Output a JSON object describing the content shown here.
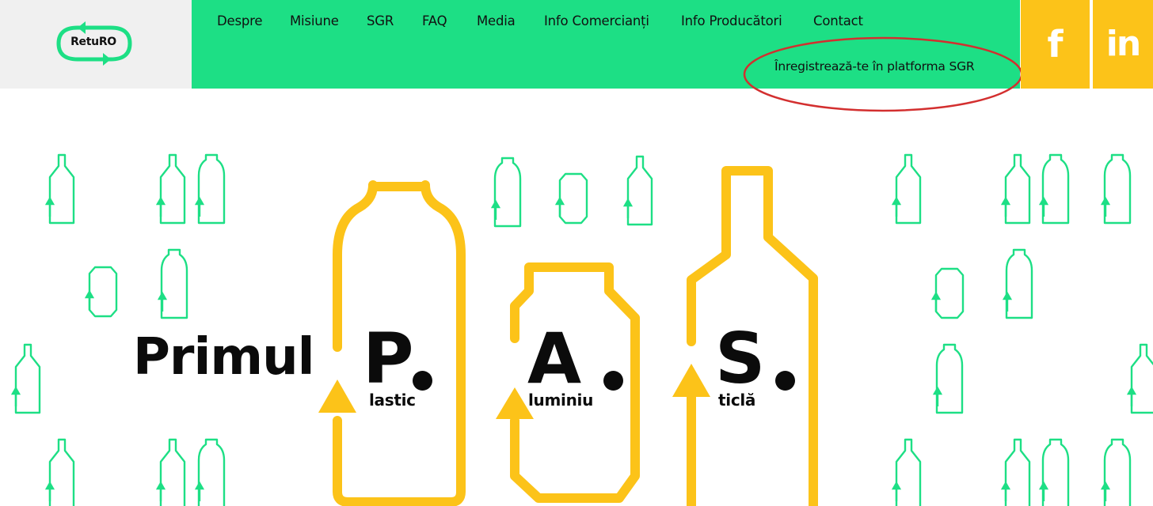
{
  "brand": {
    "logo_text": "RetuRO"
  },
  "nav": {
    "items": [
      {
        "label": "Despre"
      },
      {
        "label": "Misiune"
      },
      {
        "label": "SGR"
      },
      {
        "label": "FAQ"
      },
      {
        "label": "Media"
      },
      {
        "label": "Info Comercianți"
      },
      {
        "label": "Info Producători"
      },
      {
        "label": "Contact"
      }
    ],
    "register_link": "Înregistrează-te în platforma SGR"
  },
  "social": {
    "facebook_glyph": "f",
    "linkedin_glyph": "in",
    "icons": [
      "facebook-icon",
      "linkedin-icon"
    ]
  },
  "hero": {
    "title": "Primul",
    "letters": [
      {
        "letter": "P",
        "word": "lastic"
      },
      {
        "letter": "A",
        "word": "luminiu"
      },
      {
        "letter": "S",
        "word": "ticlă"
      }
    ]
  },
  "colors": {
    "nav_green": "#1ddf85",
    "accent_yellow": "#fcc319",
    "pattern_green": "#1ddf85",
    "annotation_red": "#d32f2f"
  }
}
